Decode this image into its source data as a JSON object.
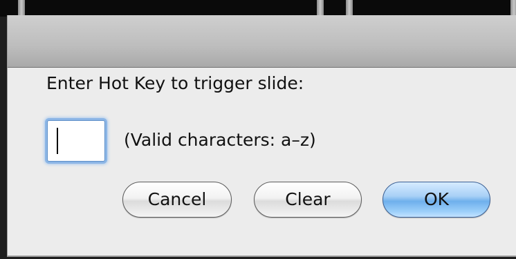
{
  "dialog": {
    "prompt": "Enter Hot Key to trigger slide:",
    "hotkey_value": "",
    "hint": "(Valid characters: a–z)",
    "buttons": {
      "cancel": "Cancel",
      "clear": "Clear",
      "ok": "OK"
    }
  },
  "colors": {
    "dialog_background": "#ececec",
    "focus_ring": "#8cb6e6",
    "default_button": "#6fb0ec"
  }
}
